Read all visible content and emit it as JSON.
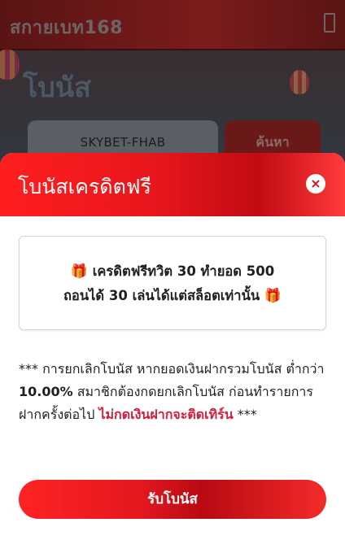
{
  "background": {
    "brand": "สกายเบท168",
    "page_title": "โบนัส",
    "promo_code_value": "SKYBET-FHAB",
    "search_label": "ค้นหา"
  },
  "modal": {
    "title": "โบนัสเครดิตฟรี",
    "close_glyph": "×",
    "info": {
      "gift_icon": "🎁",
      "line1": "เครดิตฟรีทวิต 30 ทำยอด 500",
      "line2": "ถอนได้ 30 เล่นได้แต่สล็อตเท่านั้น"
    },
    "notice": {
      "part1": "*** การยกเลิกโบนัส หากยอดเงินฝากรวมโบนัส ต่ำกว่า ",
      "percent": "10.00%",
      "part2": " สมาชิกต้องกดยกเลิกโบนัส ก่อนทำรายการฝากครั้งต่อไป ",
      "warning": "ไม่กดเงินฝากจะติดเทิร์น",
      "part3": " ***"
    },
    "claim_label": "รับโบนัส"
  },
  "colors": {
    "accent_red": "#e3171e",
    "warning_red": "#d81b3c"
  }
}
